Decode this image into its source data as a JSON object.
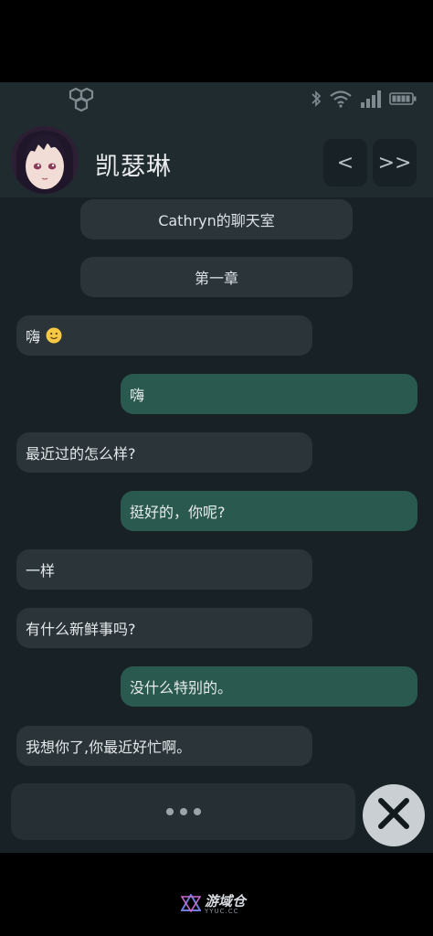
{
  "header": {
    "contact_name": "凯瑟琳",
    "prev_label": "<",
    "next_label": ">>"
  },
  "chat": {
    "messages": [
      {
        "type": "system",
        "text": "Cathryn的聊天室"
      },
      {
        "type": "system",
        "text": "第一章"
      },
      {
        "type": "incoming",
        "text": "嗨",
        "emoji": "slightly-smiling-face"
      },
      {
        "type": "outgoing",
        "text": "嗨"
      },
      {
        "type": "incoming",
        "text": "最近过的怎么样?"
      },
      {
        "type": "outgoing",
        "text": "挺好的，你呢?"
      },
      {
        "type": "incoming",
        "text": "一样"
      },
      {
        "type": "incoming",
        "text": "有什么新鲜事吗?"
      },
      {
        "type": "outgoing",
        "text": "没什么特别的。"
      },
      {
        "type": "incoming",
        "text": "我想你了,你最近好忙啊。"
      }
    ]
  },
  "input": {
    "typing_indicator": "typing-dots-icon"
  },
  "watermark": {
    "brand": "游域仓",
    "domain": "YYUC.CC"
  },
  "colors": {
    "app_bg": "#172126",
    "header_bg": "#202b30",
    "incoming_bubble": "#2a3439",
    "outgoing_bubble": "#2a5a4f",
    "close_button": "#c9cfd3"
  }
}
